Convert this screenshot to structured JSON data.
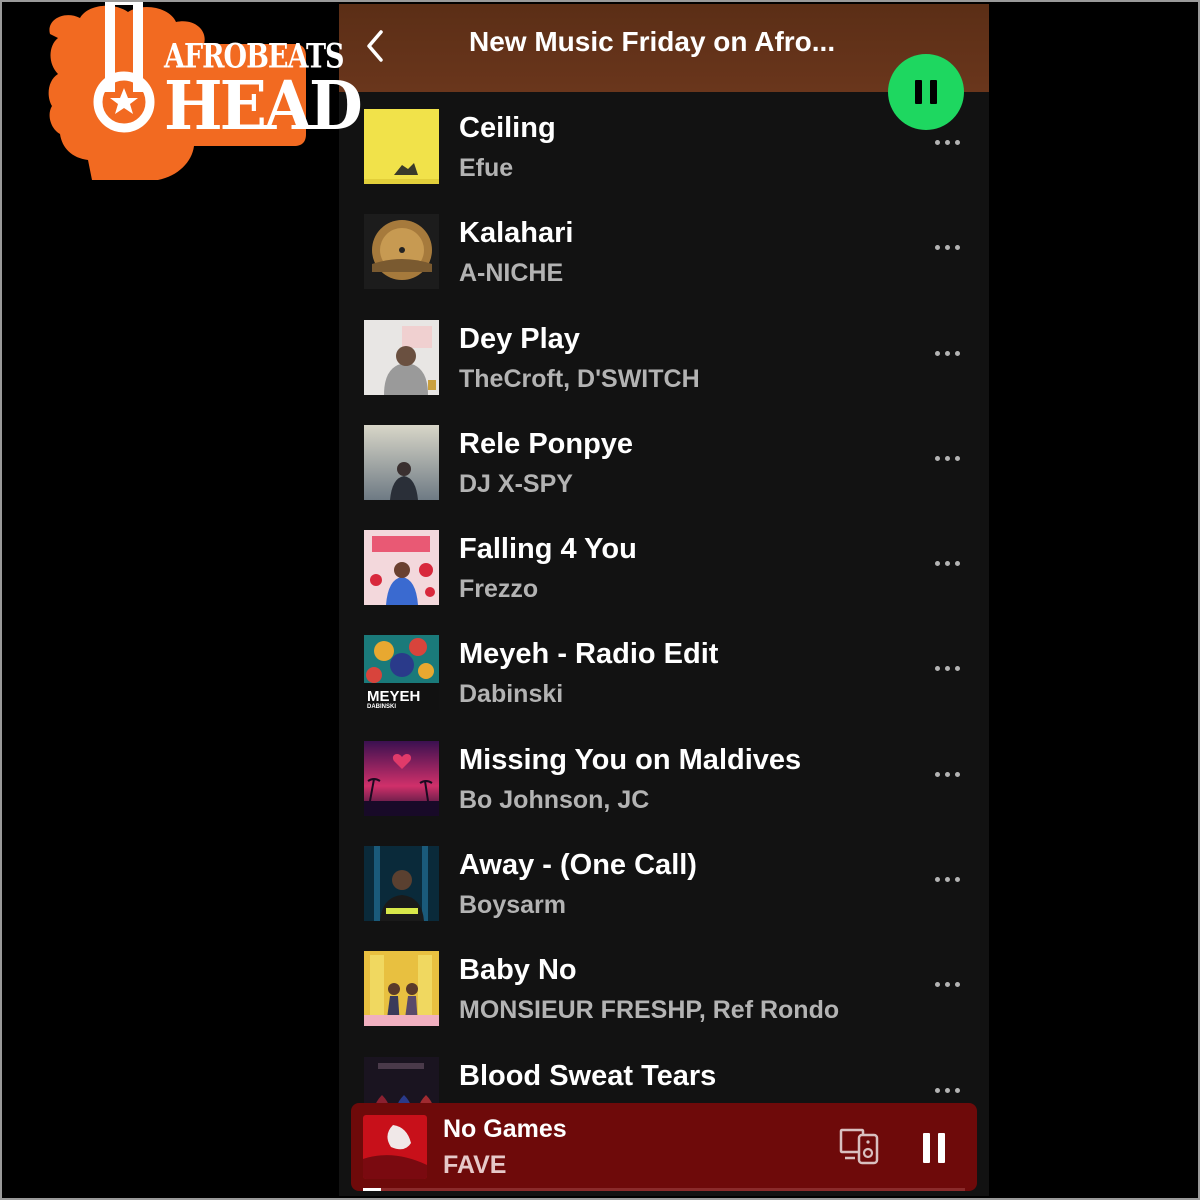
{
  "logo": {
    "line1": "AFROBEATS",
    "line2": "HEAD",
    "color": "#f26a21"
  },
  "header": {
    "title": "New Music Friday on Afro...",
    "back_icon": "chevron-left-icon",
    "background": "#6a361c"
  },
  "play_button": {
    "state": "playing",
    "icon": "pause-icon",
    "color": "#1ed760"
  },
  "tracks": [
    {
      "title": "Ceiling",
      "artist": "Efue"
    },
    {
      "title": "Kalahari",
      "artist": "A-NICHE"
    },
    {
      "title": "Dey Play",
      "artist": "TheCroft, D'SWITCH"
    },
    {
      "title": "Rele Ponpye",
      "artist": "DJ X-SPY"
    },
    {
      "title": "Falling 4 You",
      "artist": "Frezzo"
    },
    {
      "title": "Meyeh - Radio Edit",
      "artist": "Dabinski"
    },
    {
      "title": "Missing You on Maldives",
      "artist": "Bo Johnson, JC"
    },
    {
      "title": "Away - (One Call)",
      "artist": "Boysarm"
    },
    {
      "title": "Baby No",
      "artist": "MONSIEUR FRESHP, Ref Rondo"
    },
    {
      "title": "Blood Sweat Tears",
      "artist": ""
    }
  ],
  "cover_art_text": {
    "meyeh": "MEYEH",
    "meyeh_sub": "DABINSKI"
  },
  "now_playing": {
    "title": "No Games",
    "artist": "FAVE",
    "progress": 0.03,
    "background": "#6e0a0a",
    "device_icon": "devices-icon",
    "pause_icon": "pause-icon"
  }
}
